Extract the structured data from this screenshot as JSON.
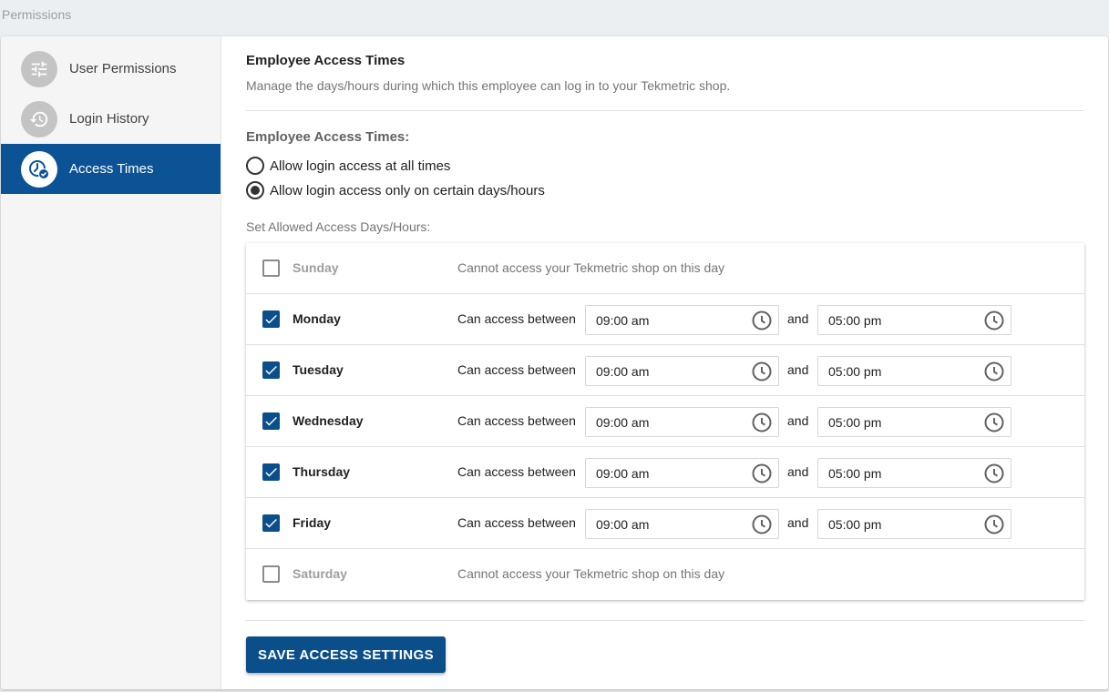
{
  "page": {
    "title": "Permissions"
  },
  "sidebar": {
    "items": [
      {
        "label": "User Permissions",
        "icon": "sliders-icon"
      },
      {
        "label": "Login History",
        "icon": "history-icon"
      },
      {
        "label": "Access Times",
        "icon": "clock-check-icon",
        "active": true
      }
    ]
  },
  "section": {
    "title": "Employee Access Times",
    "subtitle": "Manage the days/hours during which this employee can log in to your Tekmetric shop."
  },
  "access": {
    "label": "Employee Access Times:",
    "options": [
      {
        "label": "Allow login access at all times",
        "selected": false
      },
      {
        "label": "Allow login access only on certain days/hours",
        "selected": true
      }
    ],
    "set_label": "Set Allowed Access Days/Hours:"
  },
  "days": {
    "can_text": "Can access between",
    "and_text": "and",
    "cannot_text": "Cannot access your Tekmetric shop on this day",
    "rows": [
      {
        "name": "Sunday",
        "enabled": false
      },
      {
        "name": "Monday",
        "enabled": true,
        "start": "09:00 am",
        "end": "05:00 pm"
      },
      {
        "name": "Tuesday",
        "enabled": true,
        "start": "09:00 am",
        "end": "05:00 pm"
      },
      {
        "name": "Wednesday",
        "enabled": true,
        "start": "09:00 am",
        "end": "05:00 pm"
      },
      {
        "name": "Thursday",
        "enabled": true,
        "start": "09:00 am",
        "end": "05:00 pm"
      },
      {
        "name": "Friday",
        "enabled": true,
        "start": "09:00 am",
        "end": "05:00 pm"
      },
      {
        "name": "Saturday",
        "enabled": false
      }
    ]
  },
  "save_button": {
    "label": "SAVE ACCESS SETTINGS"
  },
  "colors": {
    "primary": "#0b4f8a",
    "sidebar_active": "#0b5394",
    "sidebar_bg": "#f5f5f5"
  }
}
